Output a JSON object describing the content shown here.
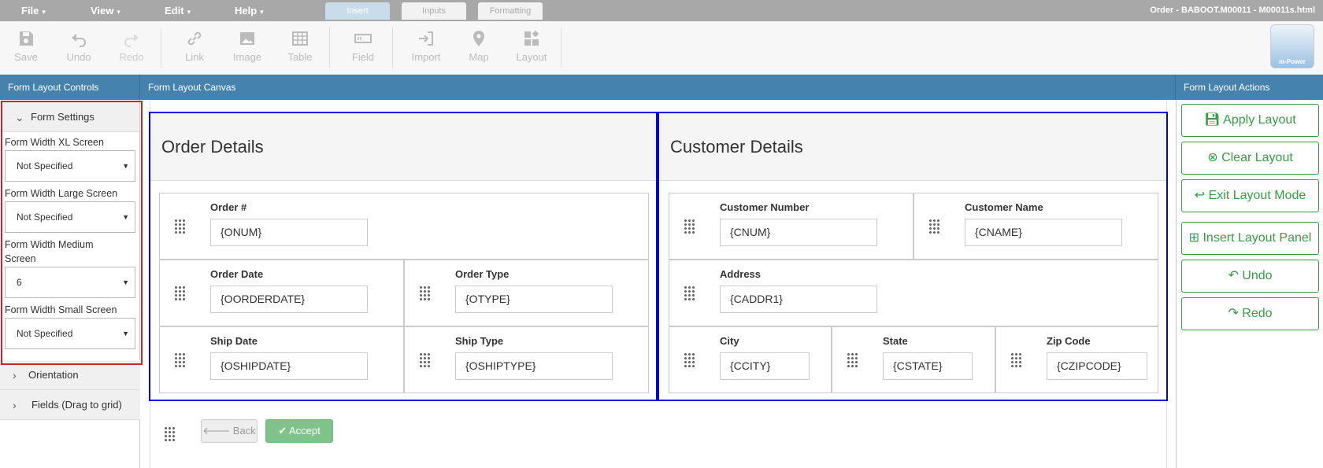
{
  "menubar": {
    "items": [
      "File",
      "View",
      "Edit",
      "Help"
    ],
    "tabs": [
      "Insert",
      "Inputs",
      "Formatting"
    ],
    "title": "Order - BABOOT.M00011 - M00011s.html"
  },
  "toolbar": {
    "save": "Save",
    "undo": "Undo",
    "redo": "Redo",
    "link": "Link",
    "image": "Image",
    "table": "Table",
    "field": "Field",
    "import": "Import",
    "map": "Map",
    "layout": "Layout",
    "logo": "m-Power"
  },
  "left": {
    "header": "Form Layout Controls",
    "form_settings": "Form Settings",
    "xl_label": "Form Width XL Screen",
    "xl_value": "Not Specified",
    "large_label": "Form Width Large Screen",
    "large_value": "Not Specified",
    "medium_label": "Form Width Medium Screen",
    "medium_value": "6",
    "small_label": "Form Width Small Screen",
    "small_value": "Not Specified",
    "orientation": "Orientation",
    "fields": "Fields (Drag to grid)"
  },
  "canvas": {
    "header": "Form Layout Canvas",
    "order_title": "Order Details",
    "customer_title": "Customer Details",
    "order_fields": {
      "onum_label": "Order #",
      "onum": "{ONUM}",
      "odate_label": "Order Date",
      "odate": "{OORDERDATE}",
      "otype_label": "Order Type",
      "otype": "{OTYPE}",
      "sdate_label": "Ship Date",
      "sdate": "{OSHIPDATE}",
      "stype_label": "Ship Type",
      "stype": "{OSHIPTYPE}"
    },
    "customer_fields": {
      "cnum_label": "Customer Number",
      "cnum": "{CNUM}",
      "cname_label": "Customer Name",
      "cname": "{CNAME}",
      "addr_label": "Address",
      "addr": "{CADDR1}",
      "city_label": "City",
      "city": "{CCITY}",
      "state_label": "State",
      "state": "{CSTATE}",
      "zip_label": "Zip Code",
      "zip": "{CZIPCODE}"
    },
    "back": "Back",
    "accept": "Accept"
  },
  "right": {
    "header": "Form Layout Actions",
    "apply": "Apply Layout",
    "clear": "Clear Layout",
    "exit": "Exit Layout Mode",
    "insert": "Insert Layout Panel",
    "undo": "Undo",
    "redo": "Redo"
  },
  "colors": {
    "accent": "#4682ae",
    "panel_border": "#0000e6",
    "action_green": "#3a9b47",
    "highlight": "#c1272d"
  }
}
